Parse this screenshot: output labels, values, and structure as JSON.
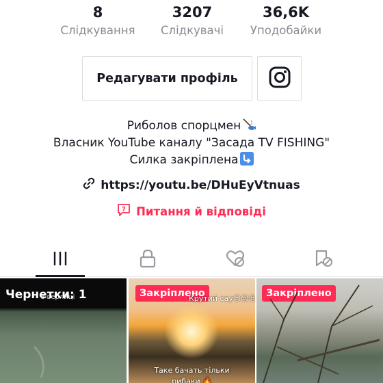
{
  "stats": [
    {
      "value": "8",
      "label": "Слідкування"
    },
    {
      "value": "3207",
      "label": "Слідкувачі"
    },
    {
      "value": "36,6K",
      "label": "Уподобайки"
    }
  ],
  "actions": {
    "edit_profile_label": "Редагувати профіль",
    "instagram_icon": "instagram-icon"
  },
  "bio": {
    "line1": "Риболов спорцмен",
    "line1_emoji": "fishing-pole-emoji",
    "line2": "Власник YouTube каналу \"Засада TV FISHING\"",
    "line3": "Силка закріплена",
    "line3_emoji": "arrow-down-emoji"
  },
  "link": {
    "icon": "link-icon",
    "url": "https://youtu.be/DHuEyVtnuas"
  },
  "qa": {
    "icon": "question-icon",
    "label": "Питання й відповіді"
  },
  "tabs": [
    {
      "name": "videos",
      "icon": "grid-icon",
      "active": true
    },
    {
      "name": "private",
      "icon": "lock-icon",
      "active": false
    },
    {
      "name": "liked",
      "icon": "heart-hidden-icon",
      "active": false
    },
    {
      "name": "favorites",
      "icon": "bookmark-hidden-icon",
      "active": false
    }
  ],
  "videos": [
    {
      "overlay": "Чернетки: 1",
      "overlay_small": "з верлиці"
    },
    {
      "badge": "Закріплено",
      "overlay_small": "Крутий сау😍😍😍",
      "caption_line1": "Таке бачать тільки",
      "caption_line2": "рибаки 🔥"
    },
    {
      "badge": "Закріплено"
    }
  ],
  "colors": {
    "accent": "#fe2c55",
    "text_primary": "#161823",
    "text_secondary": "#8a8b91",
    "border": "#dcdcde"
  }
}
